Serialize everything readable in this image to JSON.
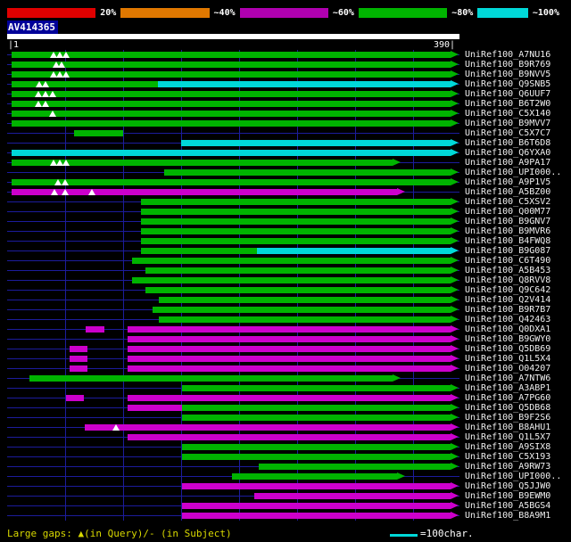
{
  "palette": {
    "green": "#00b400",
    "cyan": "#00d8d8",
    "magenta": "#cc00cc",
    "grid_line": "#1c1c9c",
    "query_bar": "#ffffff",
    "title_bg": "#000099",
    "footer_text": "#d8d800"
  },
  "footer": {
    "large_gaps_label": "Large gaps: ▲(in Query)/- (in Subject)",
    "scale_label": "=100char."
  },
  "chart_data": {
    "type": "bar",
    "orientation": "horizontal",
    "title": "AV414365",
    "x_range": [
      1,
      390
    ],
    "x_axis": {
      "left_label": "|1",
      "right_label": "390|",
      "grid_interval": 50,
      "query_length": 390
    },
    "legend_position": "top",
    "identity_key": {
      "labels": [
        "20%",
        "~40%",
        "~60%",
        "~80%",
        "~100%"
      ],
      "colors": [
        "#e00000",
        "#e07800",
        "#b000b0",
        "#00b400",
        "#00d8d8"
      ]
    },
    "rows": [
      {
        "label": "UniRef100_A7NU16",
        "segments": [
          {
            "s": 4,
            "e": 382,
            "c": "green",
            "arrow": true
          }
        ],
        "query_gaps": [
          40,
          45,
          51
        ]
      },
      {
        "label": "UniRef100_B9R769",
        "segments": [
          {
            "s": 4,
            "e": 382,
            "c": "green",
            "arrow": true
          }
        ],
        "query_gaps": [
          42,
          47
        ]
      },
      {
        "label": "UniRef100_B9NVV5",
        "segments": [
          {
            "s": 4,
            "e": 382,
            "c": "green",
            "arrow": true
          }
        ],
        "query_gaps": [
          40,
          45,
          51
        ]
      },
      {
        "label": "UniRef100_Q9SNB5",
        "segments": [
          {
            "s": 4,
            "e": 130,
            "c": "green",
            "arrow": false
          },
          {
            "s": 130,
            "e": 382,
            "c": "cyan",
            "arrow": true
          }
        ],
        "query_gaps": [
          28,
          33
        ]
      },
      {
        "label": "UniRef100_Q6UUF7",
        "segments": [
          {
            "s": 4,
            "e": 382,
            "c": "green",
            "arrow": true
          }
        ],
        "query_gaps": [
          27,
          33,
          39
        ]
      },
      {
        "label": "UniRef100_B6T2W0",
        "segments": [
          {
            "s": 4,
            "e": 382,
            "c": "green",
            "arrow": true
          }
        ],
        "query_gaps": [
          27,
          33
        ]
      },
      {
        "label": "UniRef100_C5X140",
        "segments": [
          {
            "s": 4,
            "e": 382,
            "c": "green",
            "arrow": true
          }
        ],
        "query_gaps": [
          39
        ]
      },
      {
        "label": "UniRef100_B9MVV7",
        "segments": [
          {
            "s": 4,
            "e": 382,
            "c": "green",
            "arrow": true
          }
        ],
        "query_gaps": []
      },
      {
        "label": "UniRef100_C5X7C7",
        "segments": [
          {
            "s": 58,
            "e": 100,
            "c": "green",
            "arrow": false
          }
        ],
        "query_gaps": []
      },
      {
        "label": "UniRef100_B6T6D8",
        "segments": [
          {
            "s": 150,
            "e": 382,
            "c": "cyan",
            "arrow": true
          }
        ],
        "query_gaps": []
      },
      {
        "label": "UniRef100_Q6YXA0",
        "segments": [
          {
            "s": 4,
            "e": 382,
            "c": "cyan",
            "arrow": true
          }
        ],
        "query_gaps": []
      },
      {
        "label": "UniRef100_A9PA17",
        "segments": [
          {
            "s": 4,
            "e": 332,
            "c": "green",
            "arrow": true
          }
        ],
        "query_gaps": [
          40,
          45,
          51
        ]
      },
      {
        "label": "UniRef100_UPI000..",
        "segments": [
          {
            "s": 135,
            "e": 382,
            "c": "green",
            "arrow": true
          }
        ],
        "query_gaps": []
      },
      {
        "label": "UniRef100_A9P1V5",
        "segments": [
          {
            "s": 4,
            "e": 382,
            "c": "green",
            "arrow": true
          }
        ],
        "query_gaps": [
          44,
          50
        ]
      },
      {
        "label": "UniRef100_A5BZ00",
        "segments": [
          {
            "s": 4,
            "e": 336,
            "c": "magenta",
            "arrow": true
          }
        ],
        "query_gaps": [
          41,
          50,
          73
        ]
      },
      {
        "label": "UniRef100_C5XSV2",
        "segments": [
          {
            "s": 115,
            "e": 382,
            "c": "green",
            "arrow": true
          }
        ],
        "query_gaps": []
      },
      {
        "label": "UniRef100_Q00M77",
        "segments": [
          {
            "s": 115,
            "e": 382,
            "c": "green",
            "arrow": true
          }
        ],
        "query_gaps": []
      },
      {
        "label": "UniRef100_B9GNV7",
        "segments": [
          {
            "s": 115,
            "e": 382,
            "c": "green",
            "arrow": true
          }
        ],
        "query_gaps": []
      },
      {
        "label": "UniRef100_B9MVR6",
        "segments": [
          {
            "s": 115,
            "e": 382,
            "c": "green",
            "arrow": true
          }
        ],
        "query_gaps": []
      },
      {
        "label": "UniRef100_B4FWQ8",
        "segments": [
          {
            "s": 115,
            "e": 382,
            "c": "green",
            "arrow": true
          }
        ],
        "query_gaps": []
      },
      {
        "label": "UniRef100_B9G087",
        "segments": [
          {
            "s": 115,
            "e": 215,
            "c": "green",
            "arrow": false
          },
          {
            "s": 215,
            "e": 382,
            "c": "cyan",
            "arrow": true
          }
        ],
        "query_gaps": []
      },
      {
        "label": "UniRef100_C6T490",
        "segments": [
          {
            "s": 108,
            "e": 382,
            "c": "green",
            "arrow": true
          }
        ],
        "query_gaps": []
      },
      {
        "label": "UniRef100_A5B453",
        "segments": [
          {
            "s": 119,
            "e": 382,
            "c": "green",
            "arrow": true
          }
        ],
        "query_gaps": []
      },
      {
        "label": "UniRef100_Q8RVV8",
        "segments": [
          {
            "s": 108,
            "e": 382,
            "c": "green",
            "arrow": true
          }
        ],
        "query_gaps": []
      },
      {
        "label": "UniRef100_Q9C642",
        "segments": [
          {
            "s": 119,
            "e": 382,
            "c": "green",
            "arrow": true
          }
        ],
        "query_gaps": []
      },
      {
        "label": "UniRef100_Q2V414",
        "segments": [
          {
            "s": 131,
            "e": 382,
            "c": "green",
            "arrow": true
          }
        ],
        "query_gaps": []
      },
      {
        "label": "UniRef100_B9R7B7",
        "segments": [
          {
            "s": 125,
            "e": 382,
            "c": "green",
            "arrow": true
          }
        ],
        "query_gaps": []
      },
      {
        "label": "UniRef100_Q42463",
        "segments": [
          {
            "s": 131,
            "e": 382,
            "c": "green",
            "arrow": true
          }
        ],
        "query_gaps": []
      },
      {
        "label": "UniRef100_Q0DXA1",
        "segments": [
          {
            "s": 68,
            "e": 84,
            "c": "magenta",
            "arrow": false
          },
          {
            "s": 104,
            "e": 382,
            "c": "magenta",
            "arrow": true
          }
        ],
        "query_gaps": []
      },
      {
        "label": "UniRef100_B9GWY0",
        "segments": [
          {
            "s": 104,
            "e": 382,
            "c": "magenta",
            "arrow": true
          }
        ],
        "query_gaps": []
      },
      {
        "label": "UniRef100_Q5DB69",
        "segments": [
          {
            "s": 54,
            "e": 69,
            "c": "magenta",
            "arrow": false
          },
          {
            "s": 104,
            "e": 382,
            "c": "magenta",
            "arrow": true
          }
        ],
        "query_gaps": []
      },
      {
        "label": "UniRef100_Q1L5X4",
        "segments": [
          {
            "s": 54,
            "e": 69,
            "c": "magenta",
            "arrow": false
          },
          {
            "s": 104,
            "e": 382,
            "c": "magenta",
            "arrow": true
          }
        ],
        "query_gaps": []
      },
      {
        "label": "UniRef100_O04207",
        "segments": [
          {
            "s": 54,
            "e": 69,
            "c": "magenta",
            "arrow": false
          },
          {
            "s": 104,
            "e": 382,
            "c": "magenta",
            "arrow": true
          }
        ],
        "query_gaps": []
      },
      {
        "label": "UniRef100_A7NTW6",
        "segments": [
          {
            "s": 19,
            "e": 332,
            "c": "green",
            "arrow": true
          }
        ],
        "query_gaps": []
      },
      {
        "label": "UniRef100_A3ABP1",
        "segments": [
          {
            "s": 151,
            "e": 382,
            "c": "green",
            "arrow": true
          }
        ],
        "query_gaps": []
      },
      {
        "label": "UniRef100_A7PG60",
        "segments": [
          {
            "s": 51,
            "e": 66,
            "c": "magenta",
            "arrow": false
          },
          {
            "s": 104,
            "e": 382,
            "c": "magenta",
            "arrow": true
          }
        ],
        "query_gaps": []
      },
      {
        "label": "UniRef100_Q5DB68",
        "segments": [
          {
            "s": 104,
            "e": 151,
            "c": "magenta",
            "arrow": false
          },
          {
            "s": 151,
            "e": 382,
            "c": "green",
            "arrow": true
          }
        ],
        "query_gaps": []
      },
      {
        "label": "UniRef100_B9F2S6",
        "segments": [
          {
            "s": 151,
            "e": 382,
            "c": "green",
            "arrow": true
          }
        ],
        "query_gaps": []
      },
      {
        "label": "UniRef100_B8AHU1",
        "segments": [
          {
            "s": 67,
            "e": 382,
            "c": "magenta",
            "arrow": true
          }
        ],
        "query_gaps": [
          94
        ]
      },
      {
        "label": "UniRef100_Q1L5X7",
        "segments": [
          {
            "s": 104,
            "e": 382,
            "c": "magenta",
            "arrow": true
          }
        ],
        "query_gaps": []
      },
      {
        "label": "UniRef100_A9SIX8",
        "segments": [
          {
            "s": 151,
            "e": 382,
            "c": "green",
            "arrow": true
          }
        ],
        "query_gaps": []
      },
      {
        "label": "UniRef100_C5X193",
        "segments": [
          {
            "s": 151,
            "e": 382,
            "c": "green",
            "arrow": true
          }
        ],
        "query_gaps": []
      },
      {
        "label": "UniRef100_A9RW73",
        "segments": [
          {
            "s": 217,
            "e": 382,
            "c": "green",
            "arrow": true
          }
        ],
        "query_gaps": []
      },
      {
        "label": "UniRef100_UPI000..",
        "segments": [
          {
            "s": 194,
            "e": 336,
            "c": "green",
            "arrow": true
          }
        ],
        "query_gaps": []
      },
      {
        "label": "UniRef100_Q5JJW0",
        "segments": [
          {
            "s": 151,
            "e": 382,
            "c": "magenta",
            "arrow": true
          }
        ],
        "query_gaps": []
      },
      {
        "label": "UniRef100_B9EWM0",
        "segments": [
          {
            "s": 213,
            "e": 382,
            "c": "magenta",
            "arrow": true
          }
        ],
        "query_gaps": []
      },
      {
        "label": "UniRef100_A5BGS4",
        "segments": [
          {
            "s": 151,
            "e": 382,
            "c": "magenta",
            "arrow": true
          }
        ],
        "query_gaps": []
      },
      {
        "label": "UniRef100_B8A9M1",
        "segments": [
          {
            "s": 151,
            "e": 382,
            "c": "magenta",
            "arrow": true
          }
        ],
        "query_gaps": []
      }
    ]
  }
}
